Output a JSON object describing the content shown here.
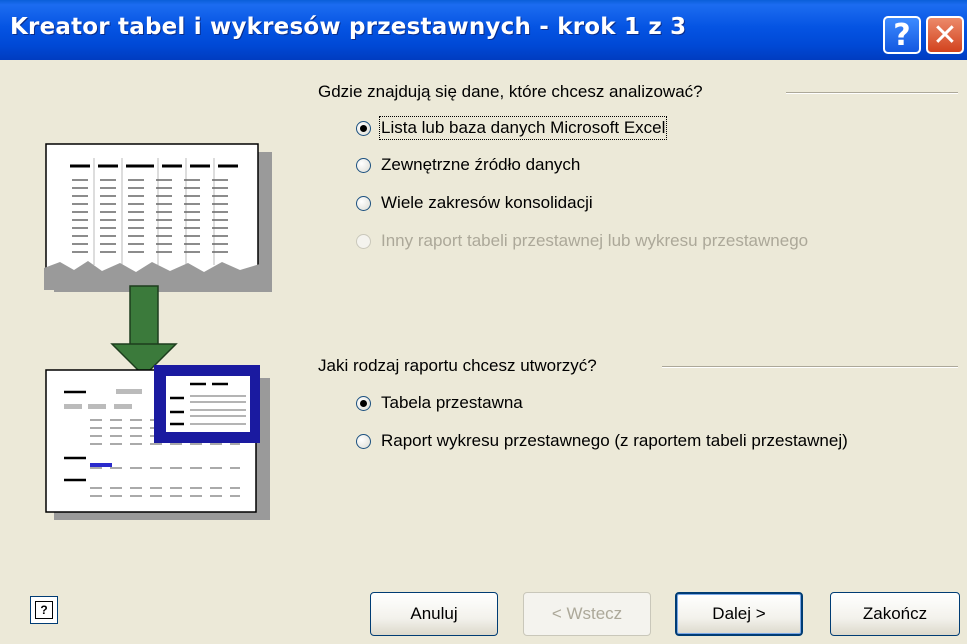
{
  "window": {
    "title": "Kreator tabel i wykresów przestawnych - krok 1 z 3",
    "help_glyph": "?",
    "close_glyph": "✕"
  },
  "data_source": {
    "question": "Gdzie znajdują się dane, które chcesz analizować?",
    "options": [
      {
        "label": "Lista lub baza danych Microsoft Excel",
        "selected": true,
        "enabled": true
      },
      {
        "label": "Zewnętrzne źródło danych",
        "selected": false,
        "enabled": true
      },
      {
        "label": "Wiele zakresów konsolidacji",
        "selected": false,
        "enabled": true
      },
      {
        "label": "Inny raport tabeli przestawnej lub wykresu przestawnego",
        "selected": false,
        "enabled": false
      }
    ]
  },
  "report_type": {
    "question": "Jaki rodzaj raportu chcesz utworzyć?",
    "options": [
      {
        "label": "Tabela przestawna",
        "selected": true,
        "enabled": true
      },
      {
        "label": "Raport wykresu przestawnego (z raportem tabeli przestawnej)",
        "selected": false,
        "enabled": true
      }
    ]
  },
  "buttons": {
    "help": "?",
    "cancel": "Anuluj",
    "back": "< Wstecz",
    "next": "Dalej >",
    "finish": "Zakończ"
  },
  "colors": {
    "titlebar": "#0554e3",
    "dialog_bg": "#ece9d8",
    "arrow": "#3b7a3b",
    "pivot_frame": "#1a1aa0"
  }
}
